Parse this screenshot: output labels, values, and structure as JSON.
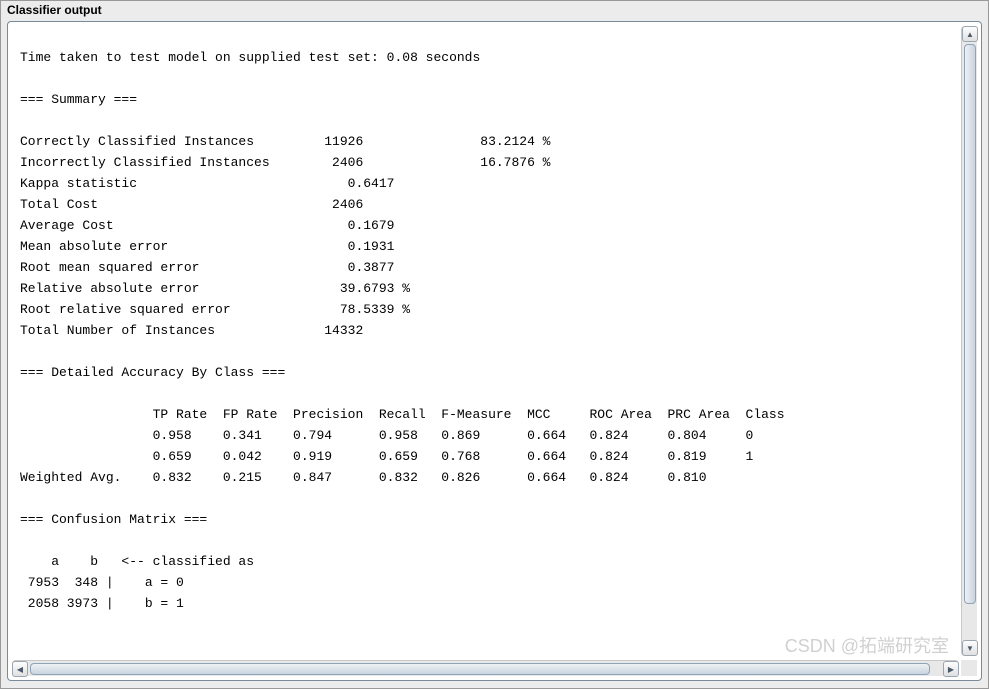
{
  "panel_title": "Classifier output",
  "time_line": "Time taken to test model on supplied test set: 0.08 seconds",
  "summary_header": "=== Summary ===",
  "summary": {
    "correctly_classified_instances": {
      "label": "Correctly Classified Instances",
      "count": "11926",
      "pct": "83.2124 %"
    },
    "incorrectly_classified_instances": {
      "label": "Incorrectly Classified Instances",
      "count": "2406",
      "pct": "16.7876 %"
    },
    "kappa_statistic": {
      "label": "Kappa statistic",
      "value": "0.6417"
    },
    "total_cost": {
      "label": "Total Cost",
      "value": "2406"
    },
    "average_cost": {
      "label": "Average Cost",
      "value": "0.1679"
    },
    "mean_absolute_error": {
      "label": "Mean absolute error",
      "value": "0.1931"
    },
    "root_mean_squared_error": {
      "label": "Root mean squared error",
      "value": "0.3877"
    },
    "relative_absolute_error": {
      "label": "Relative absolute error",
      "value": "39.6793 %"
    },
    "root_relative_squared_error": {
      "label": "Root relative squared error",
      "value": "78.5339 %"
    },
    "total_number_of_instances": {
      "label": "Total Number of Instances",
      "value": "14332"
    }
  },
  "detailed_header": "=== Detailed Accuracy By Class ===",
  "detailed_columns": [
    "TP Rate",
    "FP Rate",
    "Precision",
    "Recall",
    "F-Measure",
    "MCC",
    "ROC Area",
    "PRC Area",
    "Class"
  ],
  "detailed_rows": [
    {
      "label": "",
      "tp": "0.958",
      "fp": "0.341",
      "prec": "0.794",
      "rec": "0.958",
      "f": "0.869",
      "mcc": "0.664",
      "roc": "0.824",
      "prc": "0.804",
      "cls": "0"
    },
    {
      "label": "",
      "tp": "0.659",
      "fp": "0.042",
      "prec": "0.919",
      "rec": "0.659",
      "f": "0.768",
      "mcc": "0.664",
      "roc": "0.824",
      "prc": "0.819",
      "cls": "1"
    },
    {
      "label": "Weighted Avg.",
      "tp": "0.832",
      "fp": "0.215",
      "prec": "0.847",
      "rec": "0.832",
      "f": "0.826",
      "mcc": "0.664",
      "roc": "0.824",
      "prc": "0.810",
      "cls": ""
    }
  ],
  "confusion_header": "=== Confusion Matrix ===",
  "confusion": {
    "header": "    a    b   <-- classified as",
    "rows": [
      " 7953  348 |    a = 0",
      " 2058 3973 |    b = 1"
    ]
  },
  "watermark": "CSDN @拓端研究室"
}
